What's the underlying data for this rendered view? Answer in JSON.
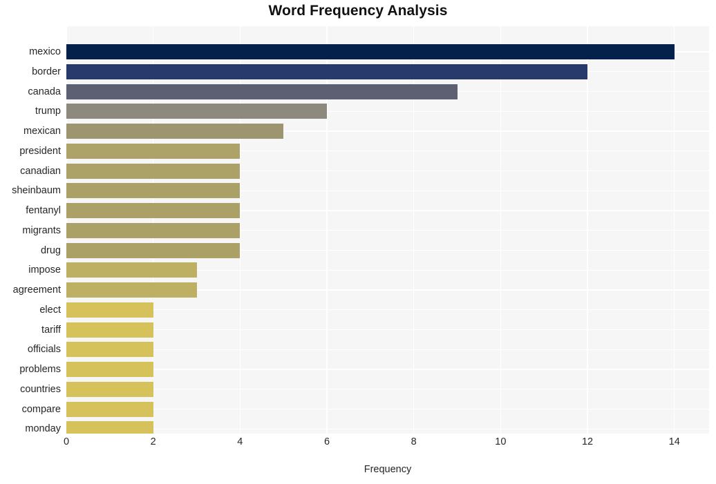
{
  "chart_data": {
    "type": "bar",
    "orientation": "horizontal",
    "title": "Word Frequency Analysis",
    "xlabel": "Frequency",
    "ylabel": "",
    "xlim": [
      0,
      14.8
    ],
    "ylim": [
      0,
      20
    ],
    "grid": true,
    "legend": null,
    "xticks": [
      0,
      2,
      4,
      6,
      8,
      10,
      12,
      14
    ],
    "xtick_labels": [
      "0",
      "2",
      "4",
      "6",
      "8",
      "10",
      "12",
      "14"
    ],
    "categories": [
      "mexico",
      "border",
      "canada",
      "trump",
      "mexican",
      "president",
      "canadian",
      "sheinbaum",
      "fentanyl",
      "migrants",
      "drug",
      "impose",
      "agreement",
      "elect",
      "tariff",
      "officials",
      "problems",
      "countries",
      "compare",
      "monday"
    ],
    "values": [
      14,
      12,
      9,
      6,
      5,
      4,
      4,
      4,
      4,
      4,
      4,
      3,
      3,
      2,
      2,
      2,
      2,
      2,
      2,
      2
    ],
    "bar_colors": [
      "#03214a",
      "#28396c",
      "#5c6072",
      "#8d897c",
      "#9c9570",
      "#ada368",
      "#ac a268",
      "#aba167",
      "#aba167",
      "#aba167",
      "#aba167",
      "#bdb062",
      "#bdb062",
      "#d6c25b",
      "#d6c25b",
      "#d6c25b",
      "#d6c25b",
      "#d6c25b",
      "#d6c25b",
      "#d6c25b"
    ],
    "plot_bgcolor": "#f6f6f6",
    "grid_color": "#ffffff",
    "figure_bgcolor": "#ffffff",
    "title_color": "#111111",
    "tick_color": "#262626"
  }
}
